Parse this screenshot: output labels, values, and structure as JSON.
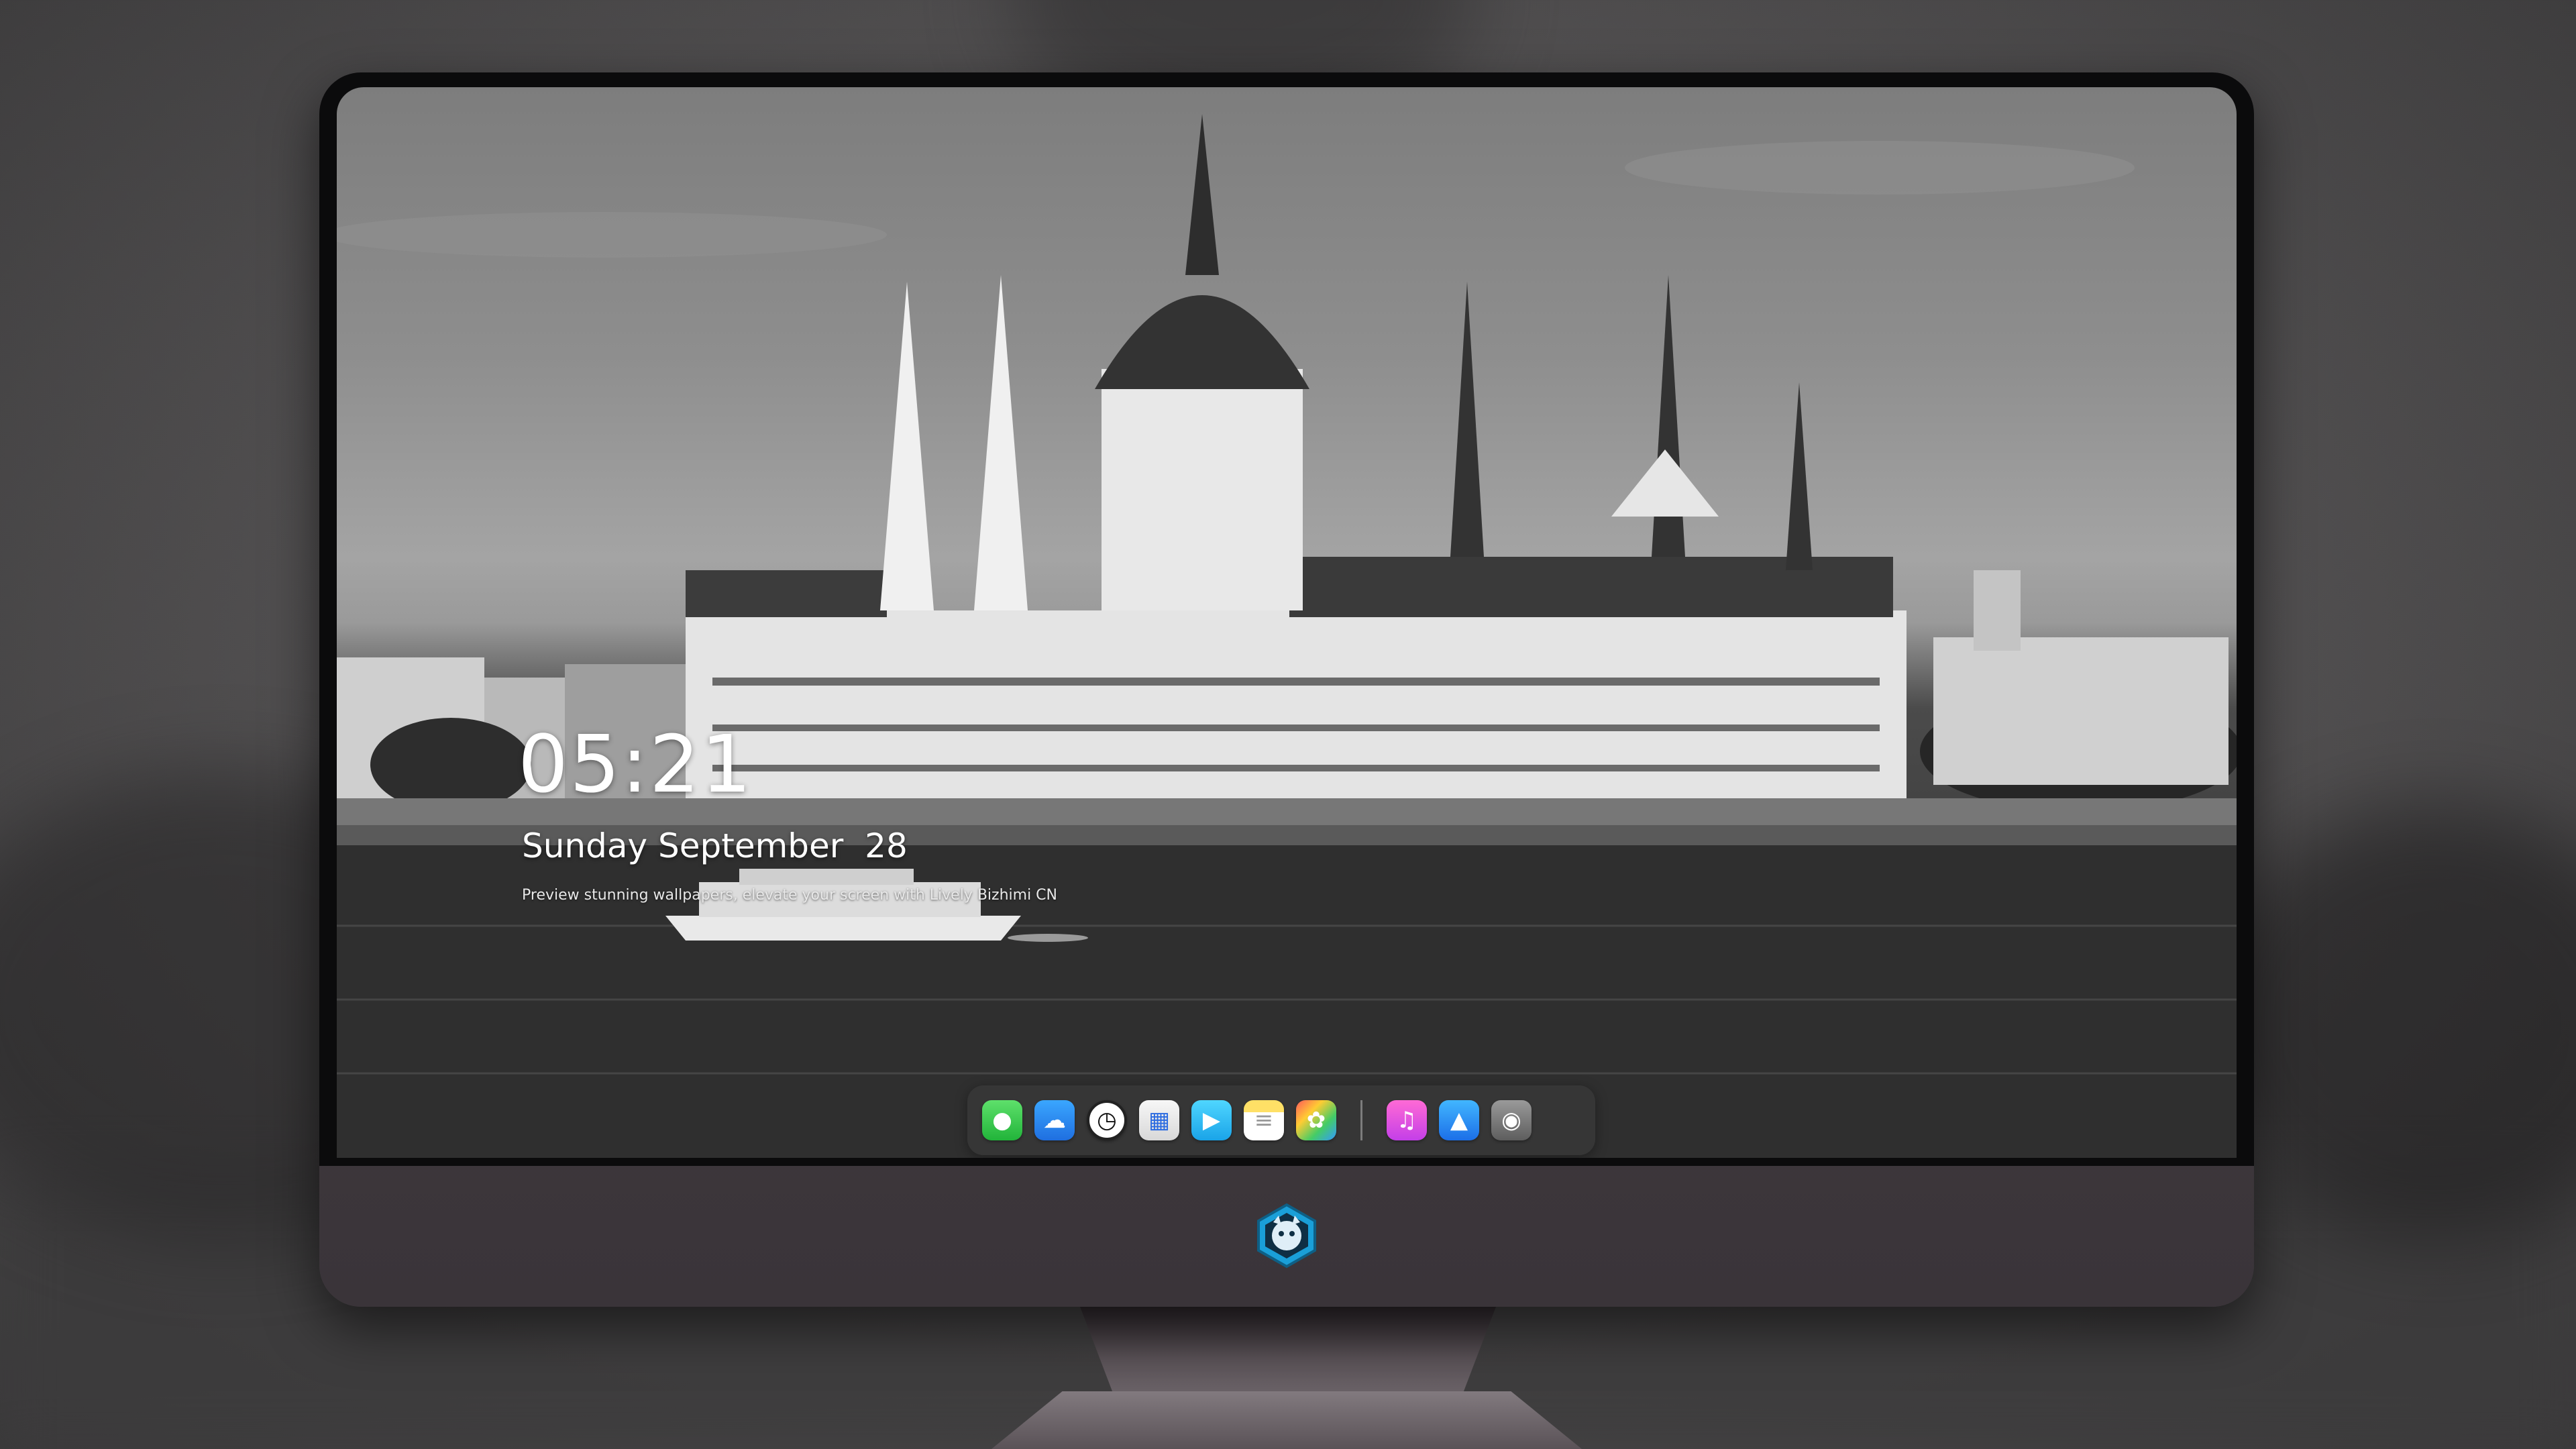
{
  "lockscreen": {
    "time": "05:21",
    "date": "Sunday September  28",
    "tagline": "Preview stunning wallpapers, elevate your screen with Lively   Bizhimi CN"
  },
  "dock": {
    "apps": [
      {
        "name": "Messages",
        "icon": "messages-icon"
      },
      {
        "name": "Weather",
        "icon": "weather-icon"
      },
      {
        "name": "Clock",
        "icon": "clock-icon"
      },
      {
        "name": "Preview",
        "icon": "preview-icon"
      },
      {
        "name": "Clips",
        "icon": "clips-icon"
      },
      {
        "name": "Notes",
        "icon": "notes-icon"
      },
      {
        "name": "Photos",
        "icon": "photos-icon"
      },
      {
        "name": "Music",
        "icon": "music-icon"
      },
      {
        "name": "App Store",
        "icon": "app-store-icon"
      },
      {
        "name": "Camera",
        "icon": "camera-icon"
      }
    ]
  },
  "colors": {
    "bezel": "#0b0b0c",
    "chin": "#3a3439",
    "text": "#ffffff"
  }
}
